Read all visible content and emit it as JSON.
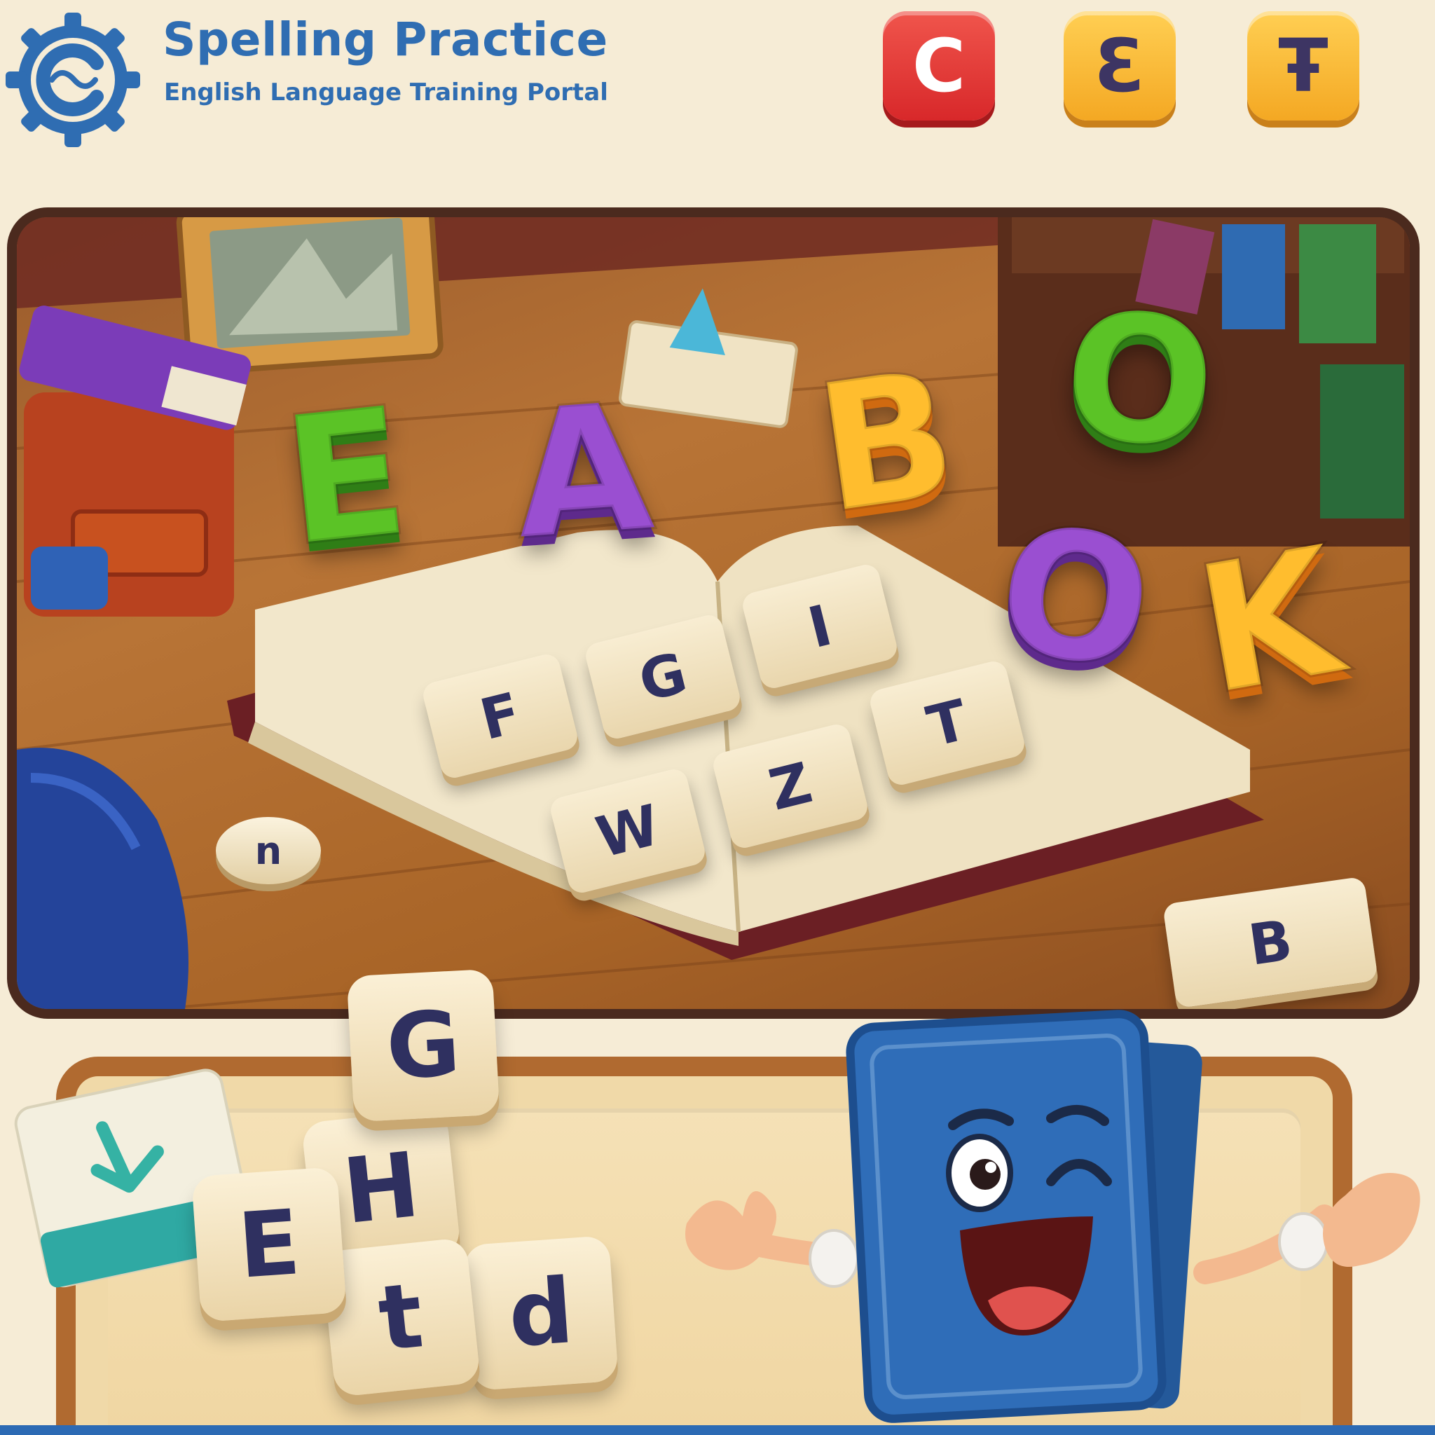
{
  "header": {
    "logo_icon": "gear-c-logo-icon",
    "title": "Spelling Practice",
    "subtitle": "English Language Training Portal",
    "tiles": [
      {
        "letter": "C",
        "color": "#e0312e"
      },
      {
        "letter": "Ɛ",
        "color": "#f7b535"
      },
      {
        "letter": "Ŧ",
        "color": "#f7b535"
      }
    ]
  },
  "scene": {
    "floating_letters": [
      "E",
      "A",
      "B",
      "O",
      "O",
      "K"
    ],
    "book_tiles": [
      "I",
      "G",
      "F",
      "T",
      "Z",
      "W"
    ],
    "coin_letter": "n",
    "corner_tile": "B"
  },
  "tray": {
    "tiles": [
      "G",
      "H",
      "E",
      "t",
      "d"
    ],
    "card_icon": "download-arrow-icon"
  },
  "mascot": {
    "name_icon": "winking-book-mascot-icon"
  },
  "colors": {
    "brand_blue": "#2f6db2",
    "board_wood": "#b06a30",
    "tile_cream": "#f4e4c1"
  }
}
